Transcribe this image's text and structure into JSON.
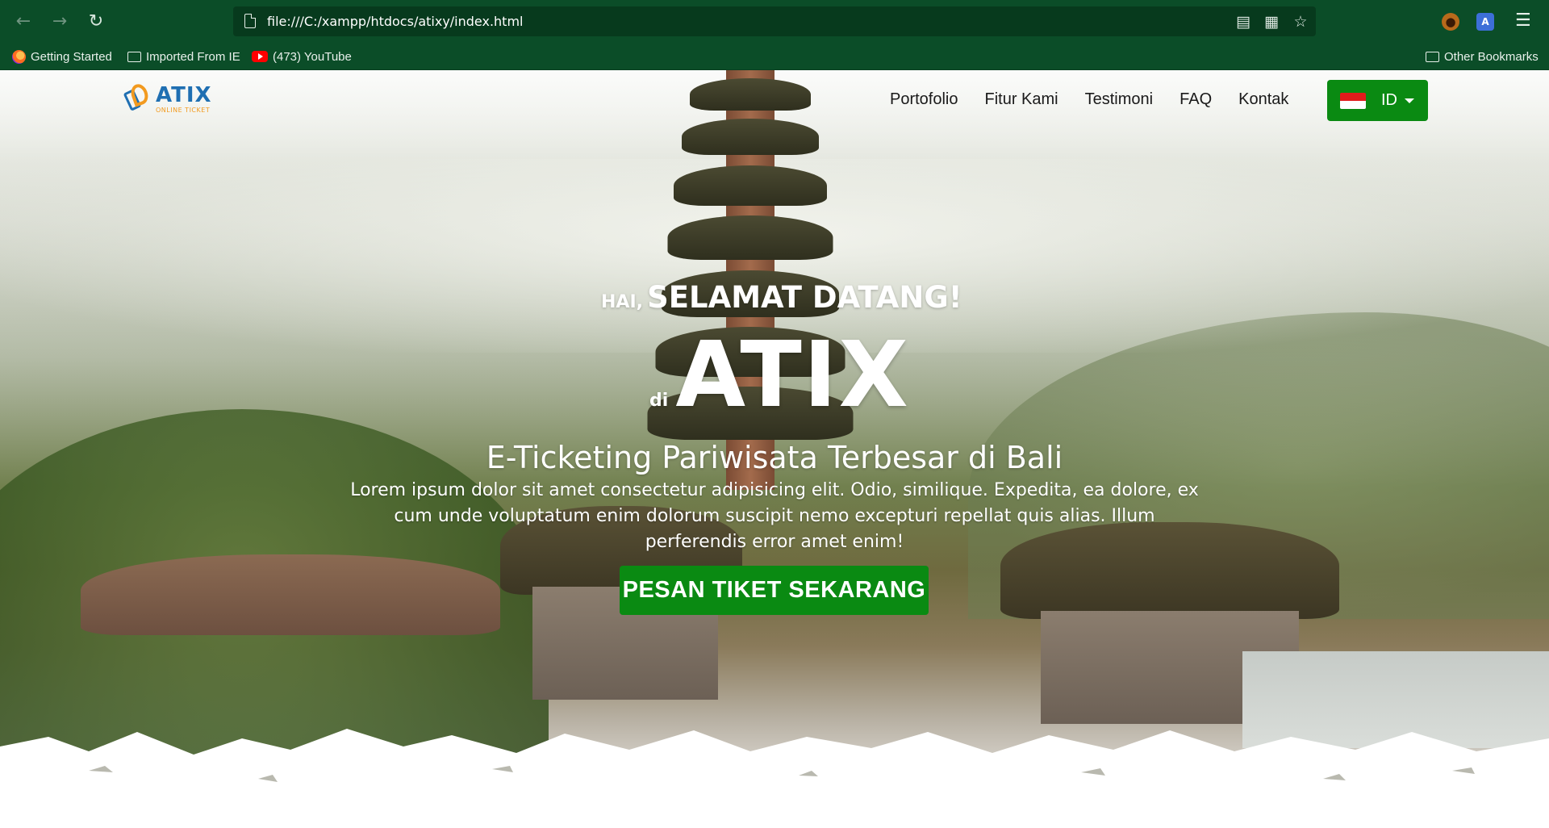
{
  "browser": {
    "url": "file:///C:/xampp/htdocs/atixy/index.html",
    "bookmarks": [
      {
        "label": "Getting Started",
        "icon": "firefox-icon"
      },
      {
        "label": "Imported From IE",
        "icon": "folder-icon"
      },
      {
        "label": "(473) YouTube",
        "icon": "youtube-icon"
      }
    ],
    "other_bookmarks": "Other Bookmarks"
  },
  "site": {
    "logo": {
      "name": "ATIX",
      "subtitle": "ONLINE TICKET"
    },
    "menu": [
      "Portofolio",
      "Fitur Kami",
      "Testimoni",
      "FAQ",
      "Kontak"
    ],
    "language": {
      "label": "ID",
      "flag": "indonesia-flag-icon"
    },
    "colors": {
      "accent": "#0a8a12",
      "logo_blue": "#1f6fb2",
      "logo_orange": "#f29a1f"
    }
  },
  "hero": {
    "greet_small": "HAI,",
    "greet_big": "SELAMAT DATANG!",
    "brand_prefix": "di",
    "brand": "ATIX",
    "tagline": "E-Ticketing Pariwisata Terbesar di Bali",
    "description": "Lorem ipsum dolor sit amet consectetur adipisicing elit. Odio, similique. Expedita, ea dolore, ex cum unde voluptatum enim dolorum suscipit nemo excepturi repellat quis alias. Illum perferendis error amet enim!",
    "cta": "PESAN TIKET SEKARANG"
  }
}
